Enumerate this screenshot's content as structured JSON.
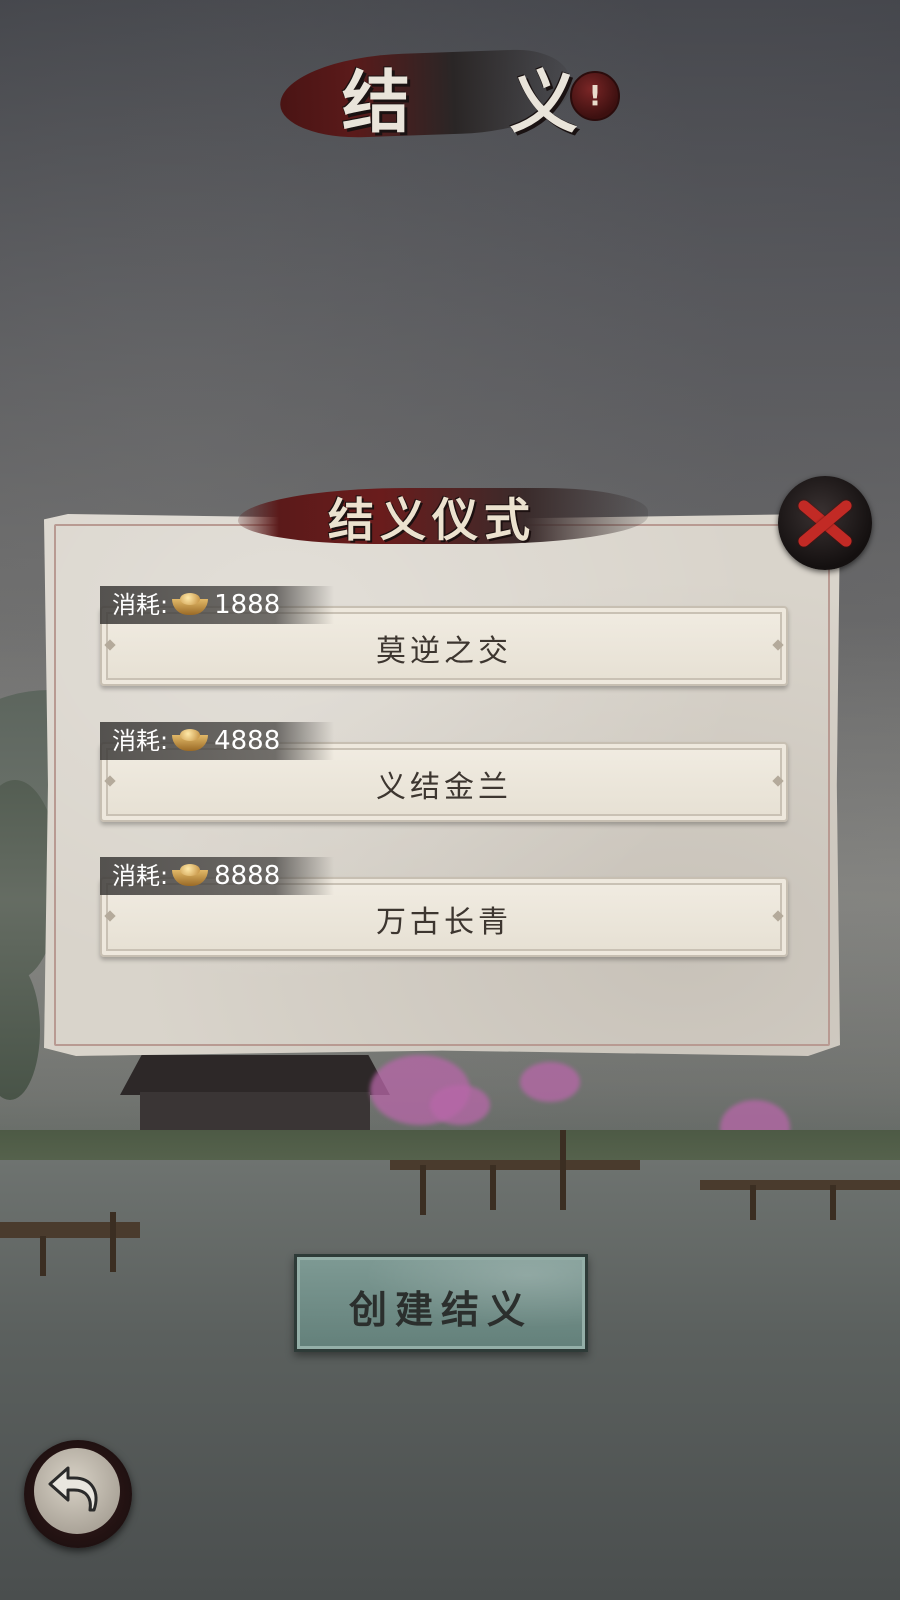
{
  "screen_title": "结 义",
  "info_badge": "!",
  "panel": {
    "title": "结义仪式",
    "options": [
      {
        "cost_label": "消耗:",
        "cost_value": "1888",
        "name": "莫逆之交"
      },
      {
        "cost_label": "消耗:",
        "cost_value": "4888",
        "name": "义结金兰"
      },
      {
        "cost_label": "消耗:",
        "cost_value": "8888",
        "name": "万古长青"
      }
    ]
  },
  "create_button": "创建结义",
  "icons": {
    "close": "close-icon",
    "info": "info-icon",
    "back": "back-arrow-icon",
    "currency": "gold-ingot-icon"
  },
  "colors": {
    "ink_red": "#5b1a1a",
    "close_x": "#c22a25",
    "create_button": "#6f8c86",
    "paper": "#d9d4cb"
  }
}
